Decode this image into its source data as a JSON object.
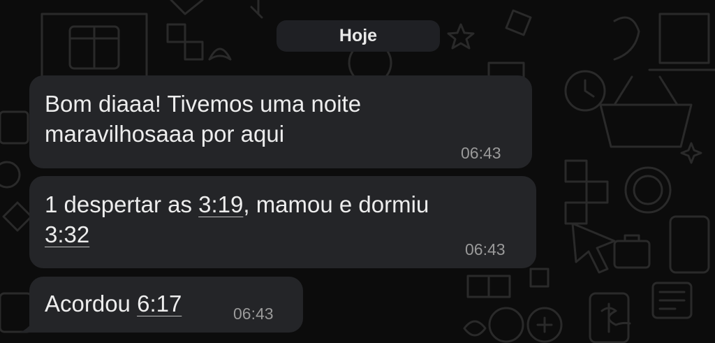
{
  "date_chip": {
    "label": "Hoje"
  },
  "messages": [
    {
      "line1": "Bom diaaa! Tivemos uma noite",
      "line2": "maravilhosaaa por aqui",
      "time": "06:43"
    },
    {
      "line1_a": "1 despertar as ",
      "line1_link": "3:19",
      "line1_b": ", mamou e dormiu",
      "line2_link": "3:32",
      "time": "06:43"
    },
    {
      "text_a": "Acordou ",
      "text_link": "6:17",
      "time": "06:43"
    }
  ],
  "colors": {
    "background": "#0c0c0c",
    "bubble": "#242528",
    "date_chip": "#1f2024",
    "text": "#ededed",
    "timestamp": "#9a9a9a"
  }
}
